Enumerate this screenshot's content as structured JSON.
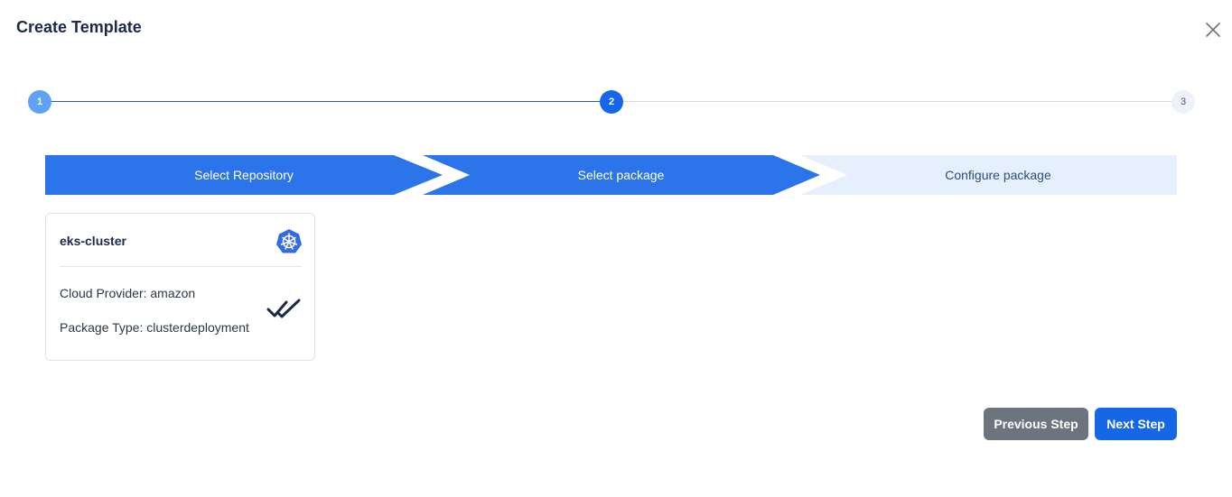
{
  "dialog": {
    "title": "Create Template"
  },
  "stepper": {
    "steps": [
      {
        "number": "1",
        "state": "completed"
      },
      {
        "number": "2",
        "state": "active"
      },
      {
        "number": "3",
        "state": "pending"
      }
    ]
  },
  "wizard": {
    "stages": [
      {
        "label": "Select Repository",
        "state": "done"
      },
      {
        "label": "Select package",
        "state": "active"
      },
      {
        "label": "Configure package",
        "state": "pending"
      }
    ]
  },
  "package_card": {
    "name": "eks-cluster",
    "icon": "kubernetes-icon",
    "cloud_provider_text": "Cloud Provider: amazon",
    "package_type_text": "Package Type: clusterdeployment",
    "selected_icon": "double-check-icon"
  },
  "footer": {
    "previous_label": "Previous Step",
    "next_label": "Next Step"
  },
  "colors": {
    "primary": "#1667e8",
    "crumb_active": "#2b74ea",
    "crumb_pending": "#e6f0fc",
    "secondary_button": "#6c757d",
    "completed_step": "#5ea3f3"
  }
}
